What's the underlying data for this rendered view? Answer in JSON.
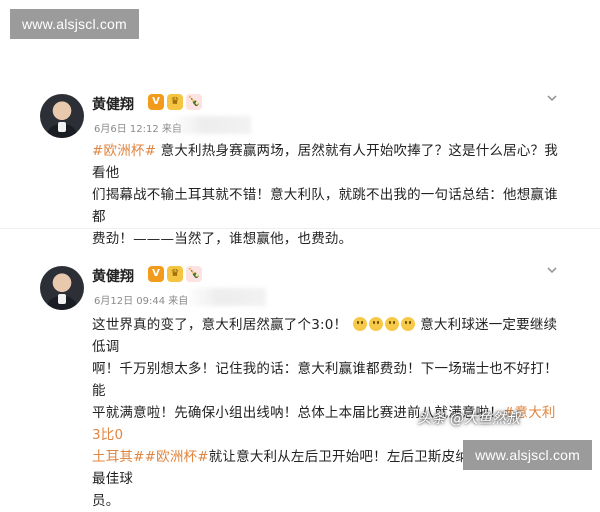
{
  "watermark_top": "www.alsjscl.com",
  "watermark_bottom": "www.alsjscl.com",
  "overlay_caption": "头条 @大鱼然叔",
  "posts": [
    {
      "author": "黄健翔",
      "badges": [
        "V",
        "♛",
        "🍾"
      ],
      "meta": "6月6日 12:12 来自",
      "hashtag": "#欧洲杯#",
      "lines": [
        " 意大利热身赛赢两场，居然就有人开始吹捧了？这是什么居心？我看他",
        "们揭幕战不输土耳其就不错！意大利队，就跳不出我的一句话总结：他想赢谁都",
        "费劲！———当然了，谁想赢他，也费劲。"
      ]
    },
    {
      "author": "黄健翔",
      "badges": [
        "V",
        "♛",
        "🍾"
      ],
      "meta": "6月12日 09:44 来自",
      "line1a": "这世界真的变了，意大利居然赢了个3:0！",
      "line1b": "意大利球迷一定要继续低调",
      "line2": "啊！千万别想太多！记住我的话：意大利赢谁都费劲！下一场瑞士也不好打！能",
      "line3a": "平就满意啦！先确保小组出线呐！总体上本届比赛进前八就满意啦！",
      "hashtag_a": "#意大利3比0",
      "hashtag_b": "土耳其##欧洲杯#",
      "line4": "就让意大利从左后卫开始吧！左后卫斯皮纳佐拉当选当场最佳球",
      "line5": "员。"
    }
  ]
}
